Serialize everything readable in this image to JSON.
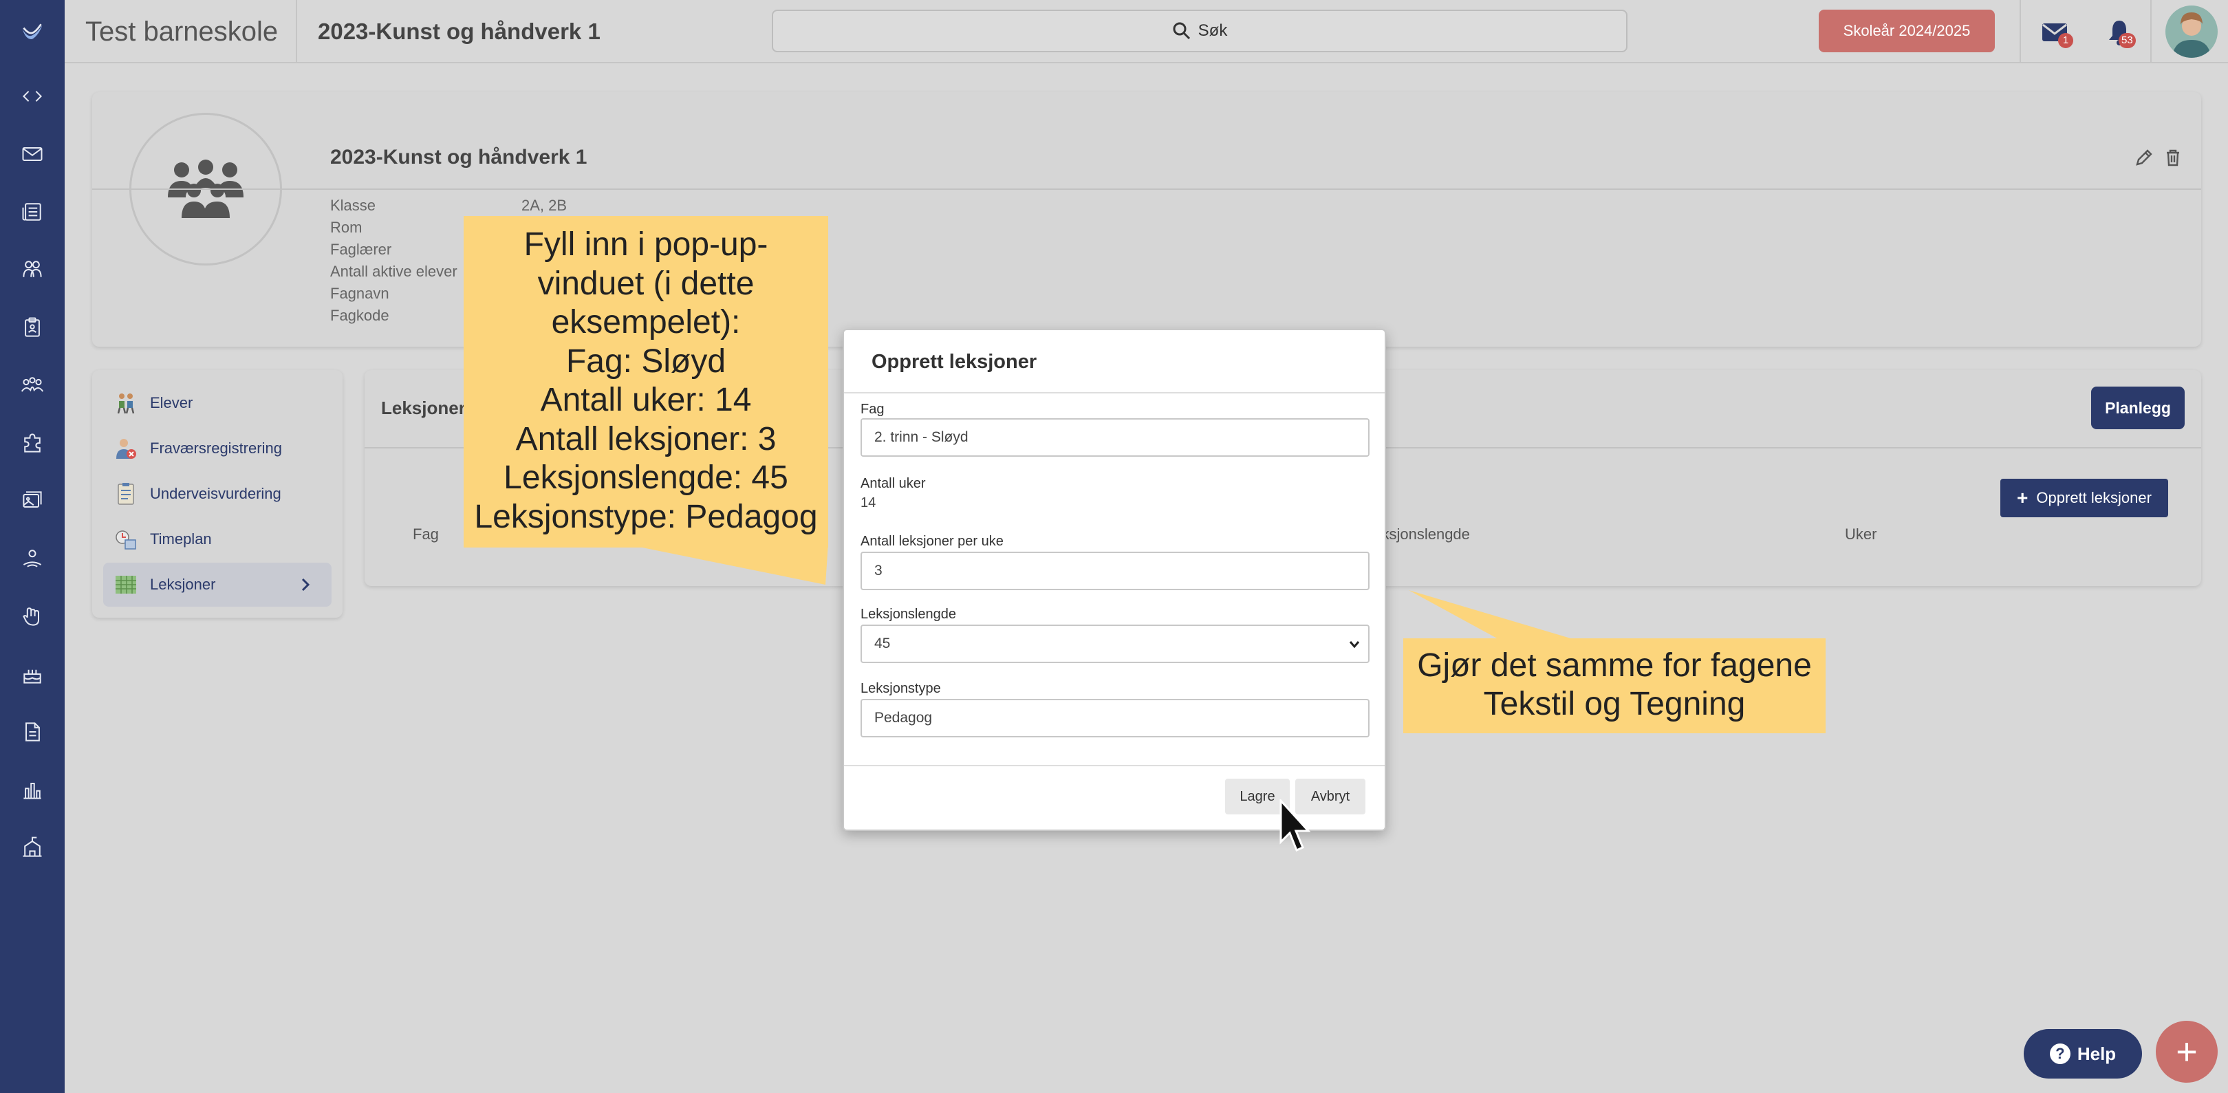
{
  "topbar": {
    "school_name": "Test barneskole",
    "course_title": "2023-Kunst og håndverk 1",
    "search_label": "Søk",
    "school_year": "Skoleår 2024/2025",
    "mail_count": "1",
    "notification_count": "53"
  },
  "header": {
    "title": "2023-Kunst og håndverk 1",
    "fields": [
      {
        "label": "Klasse",
        "value": "2A, 2B"
      },
      {
        "label": "Rom",
        "value": ""
      },
      {
        "label": "Faglærer",
        "value": ""
      },
      {
        "label": "Antall aktive elever",
        "value": ""
      },
      {
        "label": "Fagnavn",
        "value": ""
      },
      {
        "label": "Fagkode",
        "value": ""
      }
    ]
  },
  "sidenav": {
    "items": [
      {
        "label": "Elever",
        "icon": "students-icon"
      },
      {
        "label": "Fraværsregistrering",
        "icon": "absence-icon"
      },
      {
        "label": "Underveisvurdering",
        "icon": "assessment-icon"
      },
      {
        "label": "Timeplan",
        "icon": "schedule-icon"
      },
      {
        "label": "Leksjoner",
        "icon": "lessons-icon",
        "active": true
      }
    ]
  },
  "main": {
    "title": "Leksjoner",
    "plan_button": "Planlegg",
    "create_button": "Opprett leksjoner",
    "columns": [
      "Fag",
      "Leksjonslengde",
      "Uker"
    ]
  },
  "modal": {
    "title": "Opprett leksjoner",
    "fag_label": "Fag",
    "fag_value": "2. trinn - Sløyd",
    "weeks_label": "Antall uker",
    "weeks_value": "14",
    "per_week_label": "Antall leksjoner per uke",
    "per_week_value": "3",
    "length_label": "Leksjonslengde",
    "length_value": "45",
    "type_label": "Leksjonstype",
    "type_value": "Pedagog",
    "save_button": "Lagre",
    "cancel_button": "Avbryt"
  },
  "callouts": {
    "instructions": [
      "Fyll inn i pop-up-",
      "vinduet (i dette",
      "eksempelet):",
      "Fag: Sløyd",
      "Antall uker: 14",
      "Antall leksjoner: 3",
      "Leksjonslengde: 45",
      "Leksjonstype: Pedagog"
    ],
    "repeat_note": [
      "Gjør det samme for fagene",
      "Tekstil og Tegning"
    ]
  },
  "help_button": "Help",
  "fab_label": "+",
  "colors": {
    "navy": "#2b3a6b",
    "accent_red": "#c9706c",
    "callout_yellow": "#fcd57c",
    "badge_red": "#c9514d"
  }
}
